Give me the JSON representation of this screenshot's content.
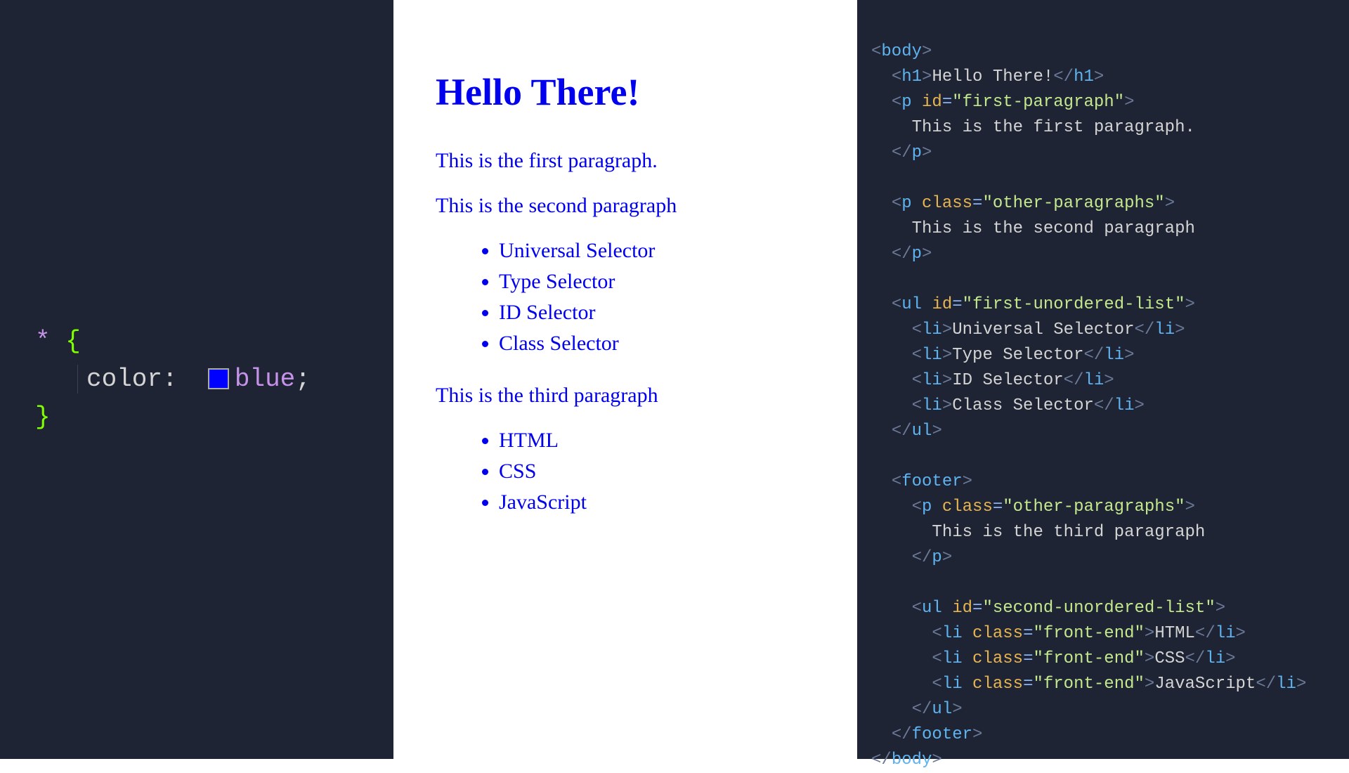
{
  "css": {
    "selector": "*",
    "property": "color",
    "value": "blue",
    "swatch_color": "#0000ff"
  },
  "rendered": {
    "heading": "Hello There!",
    "paragraph1": "This is the first paragraph.",
    "paragraph2": "This is the second paragraph",
    "list1": {
      "items": [
        "Universal Selector",
        "Type Selector",
        "ID Selector",
        "Class Selector"
      ]
    },
    "paragraph3": "This is the third paragraph",
    "list2": {
      "items": [
        "HTML",
        "CSS",
        "JavaScript"
      ]
    }
  },
  "html_code": {
    "body_tag": "body",
    "h1_tag": "h1",
    "h1_text": "Hello There!",
    "p_tag": "p",
    "ul_tag": "ul",
    "li_tag": "li",
    "footer_tag": "footer",
    "id_attr": "id",
    "class_attr": "class",
    "first_paragraph_id": "first-paragraph",
    "first_paragraph_text": "This is the first paragraph.",
    "other_paragraphs_class": "other-paragraphs",
    "second_paragraph_text": "This is the second paragraph",
    "first_ul_id": "first-unordered-list",
    "li1_text": "Universal Selector",
    "li2_text": "Type Selector",
    "li3_text": "ID Selector",
    "li4_text": "Class Selector",
    "third_paragraph_text": "This is the third paragraph",
    "second_ul_id": "second-unordered-list",
    "front_end_class": "front-end",
    "li5_text": "HTML",
    "li6_text": "CSS",
    "li7_text": "JavaScript"
  }
}
